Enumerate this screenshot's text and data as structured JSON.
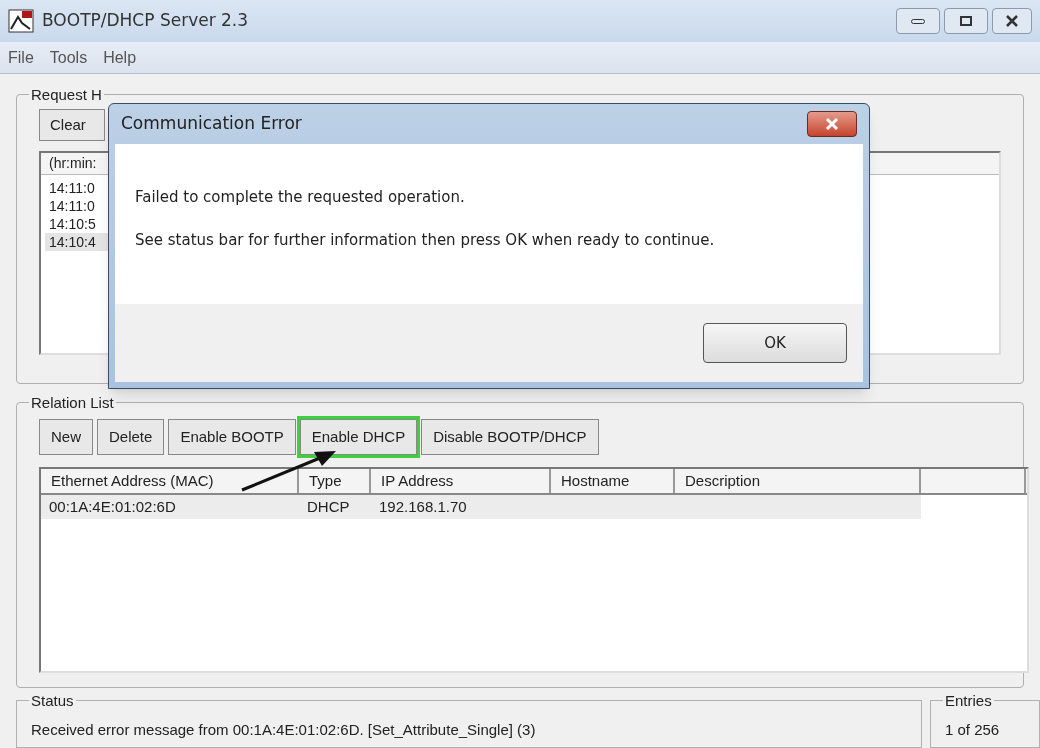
{
  "window": {
    "title": "BOOTP/DHCP Server 2.3"
  },
  "menu": [
    "File",
    "Tools",
    "Help"
  ],
  "request_history": {
    "label": "Request H",
    "clear_button": "Clear",
    "column": "(hr:min:",
    "rows": [
      {
        "time": "14:11:0",
        "selected": false
      },
      {
        "time": "14:11:0",
        "selected": false
      },
      {
        "time": "14:10:5",
        "selected": false
      },
      {
        "time": "14:10:4",
        "selected": true
      }
    ]
  },
  "relation_list": {
    "label": "Relation List",
    "buttons": [
      {
        "label": "New",
        "highlighted": false
      },
      {
        "label": "Delete",
        "highlighted": false
      },
      {
        "label": "Enable BOOTP",
        "highlighted": false
      },
      {
        "label": "Enable DHCP",
        "highlighted": true
      },
      {
        "label": "Disable BOOTP/DHCP",
        "highlighted": false
      }
    ],
    "columns": [
      "Ethernet Address (MAC)",
      "Type",
      "IP Address",
      "Hostname",
      "Description"
    ],
    "rows": [
      {
        "cells": [
          "00:1A:4E:01:02:6D",
          "DHCP",
          "192.168.1.70",
          "",
          ""
        ],
        "selected": true
      }
    ]
  },
  "status": {
    "label": "Status",
    "text": "Received error message from 00:1A:4E:01:02:6D. [Set_Attribute_Single] (3)"
  },
  "entries": {
    "label": "Entries",
    "text": "1 of 256"
  },
  "dialog": {
    "title": "Communication Error",
    "lines": [
      "Failed to complete the requested operation.",
      "See status bar for further information then press OK when ready to continue."
    ],
    "button": "OK"
  }
}
